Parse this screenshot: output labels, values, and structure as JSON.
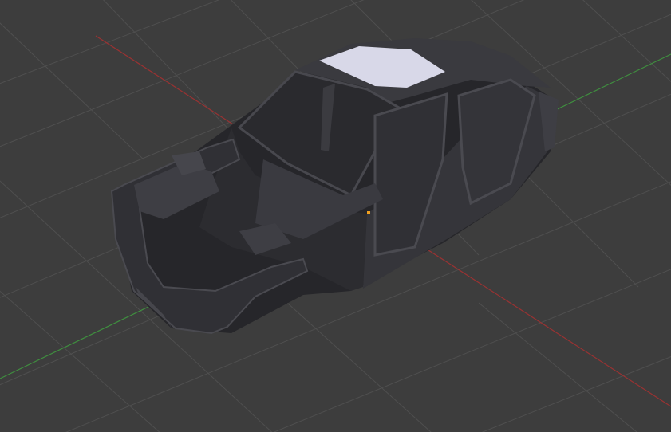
{
  "viewport": {
    "background_color": "#3d3d3d",
    "grid_line_color": "#4f4f4f",
    "x_axis_color": "#9a3232",
    "y_axis_color": "#3f8f3f",
    "origin_marker_color": "#f0a020",
    "object": "car-body-shell-mesh",
    "body_color": "#2f2f33",
    "selected_face_color": "#d8d8e8"
  }
}
